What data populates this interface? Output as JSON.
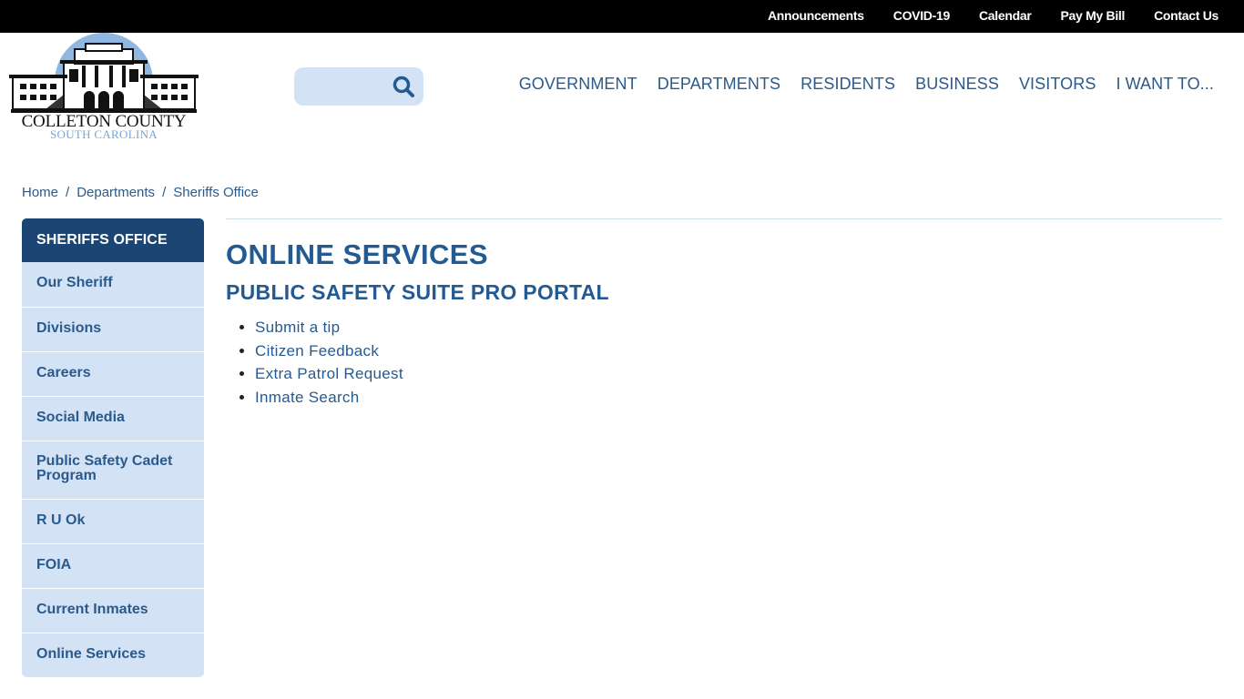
{
  "topbar": {
    "links": [
      "Announcements",
      "COVID-19",
      "Calendar",
      "Pay My Bill",
      "Contact Us"
    ]
  },
  "logo": {
    "name": "COLLETON COUNTY",
    "subtitle": "SOUTH CAROLINA"
  },
  "search": {
    "value": "",
    "placeholder": "",
    "icon": "search-icon"
  },
  "mainnav": {
    "items": [
      "GOVERNMENT",
      "DEPARTMENTS",
      "RESIDENTS",
      "BUSINESS",
      "VISITORS",
      "I WANT TO..."
    ]
  },
  "breadcrumb": {
    "items": [
      "Home",
      "Departments",
      "Sheriffs Office"
    ],
    "separator": "/"
  },
  "sidenav": {
    "title": "SHERIFFS OFFICE",
    "items": [
      "Our Sheriff",
      "Divisions",
      "Careers",
      "Social Media",
      "Public Safety Cadet Program",
      "R U Ok",
      "FOIA",
      "Current Inmates",
      "Online Services"
    ]
  },
  "content": {
    "title": "ONLINE SERVICES",
    "subtitle": "PUBLIC SAFETY SUITE PRO PORTAL",
    "links": [
      "Submit a tip",
      "Citizen Feedback",
      "Extra Patrol Request",
      "Inmate Search"
    ]
  },
  "colors": {
    "topbar_bg": "#000000",
    "primary": "#1b4674",
    "link": "#2a5a8c",
    "sidenav_bg": "#d3e3f5",
    "logo_accent": "#8fb7e0"
  }
}
